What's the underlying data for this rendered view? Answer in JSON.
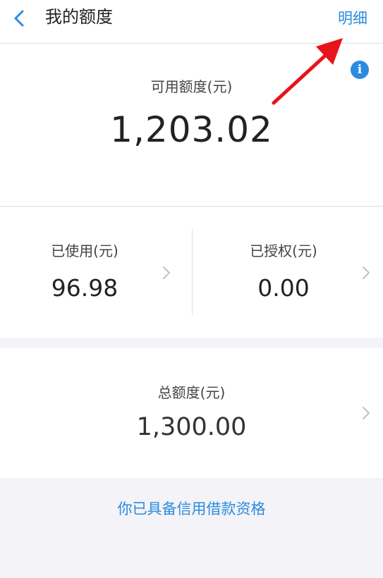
{
  "nav": {
    "title": "我的额度",
    "detail_label": "明细",
    "back_icon": "chevron-left-icon"
  },
  "available": {
    "label": "可用额度(元)",
    "value": "1,203.02",
    "info_glyph": "i"
  },
  "used": {
    "label": "已使用(元)",
    "value": "96.98"
  },
  "authorized": {
    "label": "已授权(元)",
    "value": "0.00"
  },
  "total": {
    "label": "总额度(元)",
    "value": "1,300.00"
  },
  "qualification_link": "你已具备信用借款资格",
  "colors": {
    "accent": "#2a8ce0",
    "annotation_arrow": "#e8131b",
    "background": "#f4f3f7"
  }
}
